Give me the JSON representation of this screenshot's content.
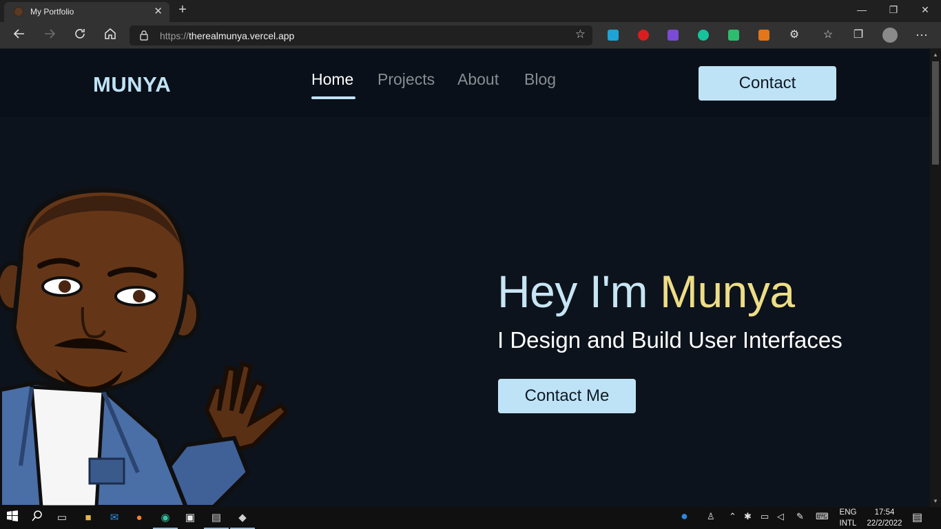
{
  "browser": {
    "tab_title": "My Portfolio",
    "tab_close": "✕",
    "new_tab": "+",
    "url_scheme": "https://",
    "url_host": "therealmunya.vercel.app",
    "window_controls": {
      "minimize": "—",
      "maximize": "❐",
      "close": "✕"
    }
  },
  "site": {
    "logo": "MUNYA",
    "nav": {
      "home": "Home",
      "projects": "Projects",
      "about": "About",
      "blog": "Blog"
    },
    "contact_button": "Contact",
    "hero": {
      "greeting": "Hey I'm ",
      "name": "Munya",
      "subtitle": "I Design and Build User Interfaces",
      "cta": "Contact Me"
    }
  },
  "taskbar": {
    "lang_top": "ENG",
    "lang_bottom": "INTL",
    "time": "17:54",
    "date": "22/2/2022"
  },
  "colors": {
    "accent": "#bfe3f6",
    "name_highlight": "#eddd86",
    "background": "#0d131c"
  }
}
